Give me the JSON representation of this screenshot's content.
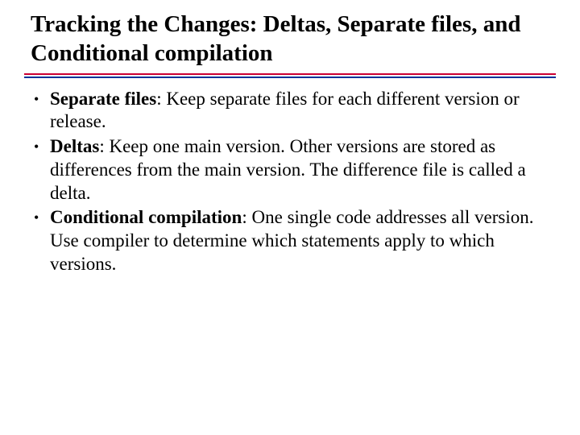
{
  "title": "Tracking the Changes: Deltas, Separate files, and Conditional compilation",
  "items": [
    {
      "term": "Separate files",
      "desc": ": Keep separate files for each different version or release."
    },
    {
      "term": "Deltas",
      "desc": ": Keep one main version. Other versions are stored as differences from the main version. The difference file is called a delta."
    },
    {
      "term": "Conditional compilation",
      "desc": ": One single code addresses all version. Use compiler to determine which statements apply to which versions."
    }
  ]
}
